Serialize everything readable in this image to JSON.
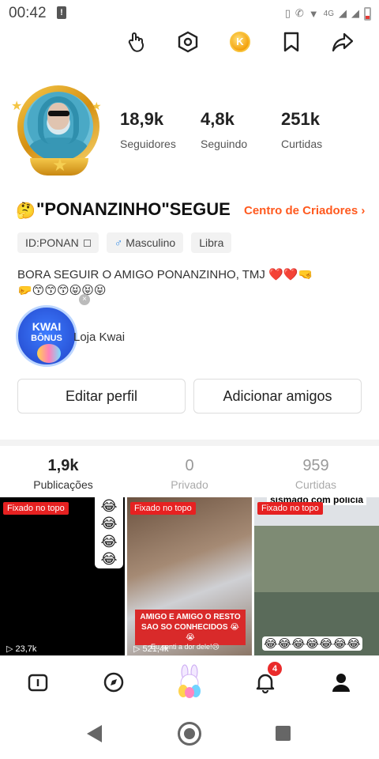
{
  "status_bar": {
    "time": "00:42",
    "network": "4G",
    "icons": [
      "alert-icon",
      "vibrate-icon",
      "call-icon",
      "wifi-icon",
      "signal-icon",
      "battery-icon"
    ]
  },
  "top_actions": [
    "hand-tap-icon",
    "settings-hexagon-icon",
    "kwai-coin-icon",
    "bookmark-icon",
    "share-icon"
  ],
  "profile": {
    "stats": [
      {
        "value": "18,9k",
        "label": "Seguidores"
      },
      {
        "value": "4,8k",
        "label": "Seguindo"
      },
      {
        "value": "251k",
        "label": "Curtidas"
      }
    ],
    "name": "\"PONANZINHO\"SEGUE",
    "name_emoji": "🤔",
    "creators_link": "Centro de Criadores",
    "tags": {
      "id": "ID:PONAN",
      "gender": "Masculino",
      "sign": "Libra"
    },
    "bio_line1": "BORA SEGUIR O AMIGO PONANZINHO, TMJ ❤️❤️🤜",
    "bio_line2": "🤛😙😙😙😝😝😝",
    "kwai_badge": {
      "title": "KWAI",
      "subtitle": "BÔNUS"
    },
    "store_label": "Loja Kwai"
  },
  "buttons": {
    "edit": "Editar perfil",
    "add_friends": "Adicionar amigos"
  },
  "tabs": [
    {
      "count": "1,9k",
      "label": "Publicações"
    },
    {
      "count": "0",
      "label": "Privado"
    },
    {
      "count": "959",
      "label": "Curtidas"
    }
  ],
  "videos": [
    {
      "pinned": "Fixado no topo",
      "views": "23,7k",
      "emojis": [
        "😂",
        "😂",
        "😂",
        "😂"
      ]
    },
    {
      "pinned": "Fixado no topo",
      "views": "521,4k",
      "caption": "AMIGO E AMIGO O RESTO SAO SO CONHECIDOS 😭😭",
      "subcaption": "Eu senti a dor dele!😢"
    },
    {
      "pinned": "Fixado no topo",
      "top_caption": "sismado com policia",
      "emojis_row": "😂😂😂😂😂😂😂"
    }
  ],
  "bottom_nav": {
    "items": [
      "home-icon",
      "discover-icon",
      "kwai-bunny-icon",
      "notification-bell-icon",
      "profile-icon"
    ],
    "notification_count": "4"
  },
  "colors": {
    "accent_orange": "#ff5a1f",
    "pinned_red": "#e62121",
    "badge_red": "#ea2b2b"
  }
}
